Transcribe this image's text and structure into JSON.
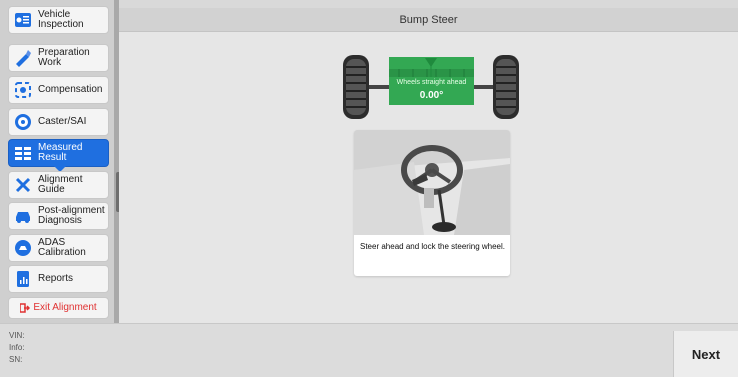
{
  "sidebar": {
    "items": [
      {
        "label_line1": "Vehicle",
        "label_line2": "Inspection",
        "icon": "vehicle-inspection-icon"
      },
      {
        "label_line1": "Preparation",
        "label_line2": "Work",
        "icon": "preparation-icon"
      },
      {
        "label_line1": "Compensation",
        "label_line2": "",
        "icon": "compensation-icon"
      },
      {
        "label_line1": "Caster/SAI",
        "label_line2": "",
        "icon": "caster-sai-icon"
      },
      {
        "label_line1": "Measured",
        "label_line2": "Result",
        "icon": "measured-result-icon",
        "active": true
      },
      {
        "label_line1": "Alignment",
        "label_line2": "Guide",
        "icon": "alignment-guide-icon"
      },
      {
        "label_line1": "Post-alignment",
        "label_line2": "Diagnosis",
        "icon": "post-alignment-icon"
      },
      {
        "label_line1": "ADAS",
        "label_line2": "Calibration",
        "icon": "adas-icon"
      },
      {
        "label_line1": "Reports",
        "label_line2": "",
        "icon": "reports-icon"
      }
    ],
    "exit_label": "Exit Alignment"
  },
  "header": {
    "title": "Bump Steer"
  },
  "wheel_status": {
    "label": "Wheels straight ahead",
    "value": "0.00°"
  },
  "instruction": "Steer ahead and lock the steering wheel.",
  "footer": {
    "vin_label": "VIN:",
    "info_label": "Info:",
    "sn_label": "SN:"
  },
  "next_label": "Next",
  "colors": {
    "accent": "#1f6fe0",
    "status_green": "#33a853",
    "exit_red": "#e03131"
  }
}
